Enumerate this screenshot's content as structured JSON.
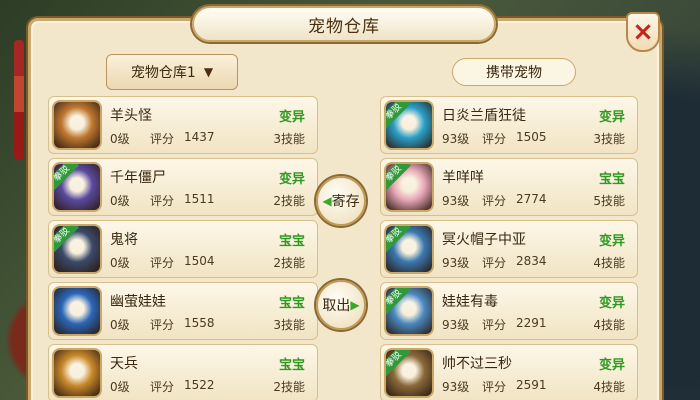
{
  "window": {
    "title": "宠物仓库",
    "close_label": "×"
  },
  "storage_dropdown": {
    "value": "宠物仓库1"
  },
  "carry_label": "携带宠物",
  "actions": {
    "deposit": "寄存",
    "withdraw": "取出"
  },
  "stat_label": "评分",
  "tag_label": "拳驳",
  "colors": {
    "panel": "#f3e7cb",
    "accent_green": "#2f9a22",
    "close_red": "#c4231b"
  },
  "storage_pets": [
    {
      "name": "羊头怪",
      "type": "变异",
      "level": "0级",
      "score": "1437",
      "skills": "3技能",
      "tagged": false,
      "face": "#c07830"
    },
    {
      "name": "千年僵尸",
      "type": "变异",
      "level": "0级",
      "score": "1511",
      "skills": "2技能",
      "tagged": true,
      "face": "#5a4aa0"
    },
    {
      "name": "鬼将",
      "type": "宝宝",
      "level": "0级",
      "score": "1504",
      "skills": "2技能",
      "tagged": true,
      "face": "#3a4a6a"
    },
    {
      "name": "幽萤娃娃",
      "type": "宝宝",
      "level": "0级",
      "score": "1558",
      "skills": "3技能",
      "tagged": false,
      "face": "#2a66b8"
    },
    {
      "name": "天兵",
      "type": "宝宝",
      "level": "0级",
      "score": "1522",
      "skills": "2技能",
      "tagged": false,
      "face": "#c8882a"
    }
  ],
  "carried_pets": [
    {
      "name": "日炎兰盾狂徒",
      "type": "变异",
      "level": "93级",
      "score": "1505",
      "skills": "3技能",
      "tagged": true,
      "face": "#2aa0c8"
    },
    {
      "name": "羊咩咩",
      "type": "宝宝",
      "level": "93级",
      "score": "2774",
      "skills": "5技能",
      "tagged": true,
      "face": "#e8a8b8"
    },
    {
      "name": "冥火帽子中亚",
      "type": "变异",
      "level": "93级",
      "score": "2834",
      "skills": "4技能",
      "tagged": true,
      "face": "#3a78b0"
    },
    {
      "name": "娃娃有毒",
      "type": "变异",
      "level": "93级",
      "score": "2291",
      "skills": "4技能",
      "tagged": true,
      "face": "#4a88c0"
    },
    {
      "name": "帅不过三秒",
      "type": "变异",
      "level": "93级",
      "score": "2591",
      "skills": "4技能",
      "tagged": true,
      "face": "#8a6a3a"
    }
  ]
}
